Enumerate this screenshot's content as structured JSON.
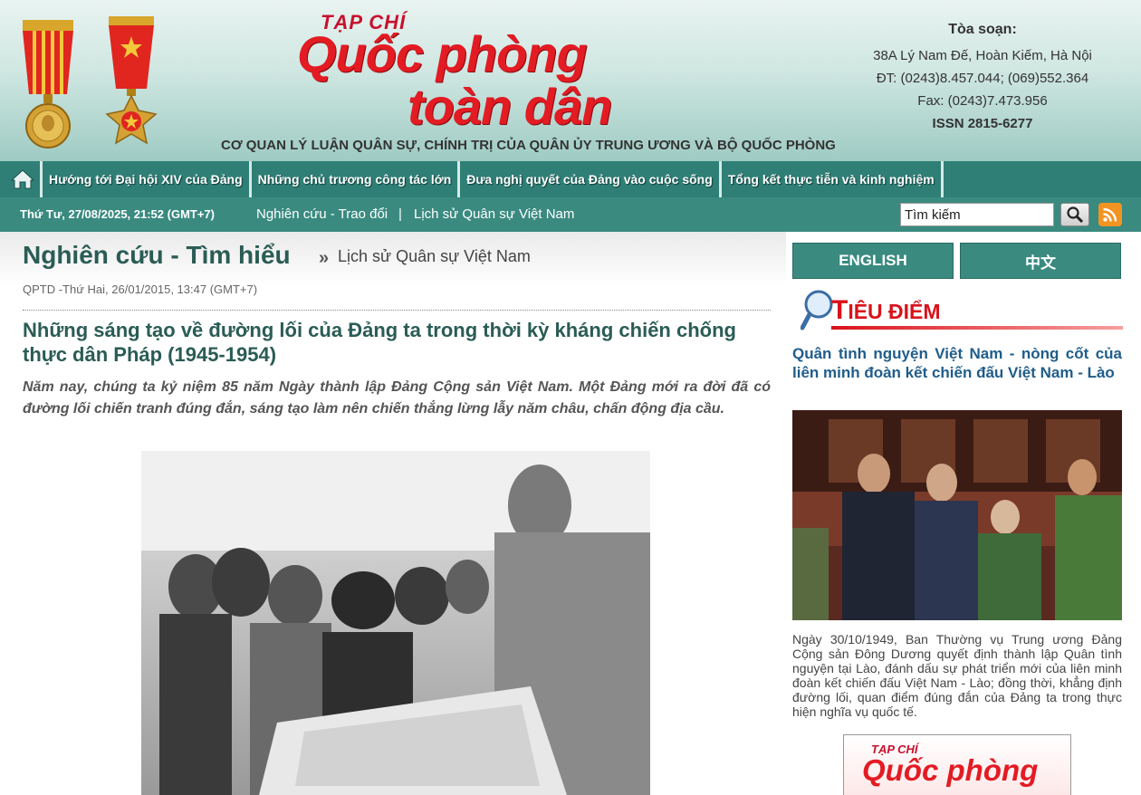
{
  "header": {
    "masthead_small": "TẠP CHÍ",
    "masthead_line1": "Quốc phòng",
    "masthead_line2": "toàn dân",
    "tagline": "CƠ QUAN LÝ LUẬN QUÂN SỰ, CHÍNH TRỊ CỦA QUÂN ỦY TRUNG ƯƠNG VÀ BỘ QUỐC PHÒNG",
    "contact": {
      "title": "Tòa soạn:",
      "address": "38A Lý Nam Đế, Hoàn Kiếm, Hà Nội",
      "phone": "ĐT: (0243)8.457.044; (069)552.364",
      "fax": "Fax: (0243)7.473.956",
      "issn": "ISSN 2815-6277"
    },
    "colors": {
      "brand_red": "#e31b23",
      "teal": "#2f7f76"
    }
  },
  "nav": {
    "home_icon": "home-icon",
    "items": [
      "Hướng tới Đại hội XIV của Đảng",
      "Những chủ trương công tác lớn",
      "Đưa nghị quyết của Đảng vào cuộc sống",
      "Tổng kết thực tiễn và kinh nghiệm"
    ]
  },
  "subbar": {
    "date": "Thứ Tư, 27/08/2025, 21:52 (GMT+7)",
    "crumb1": "Nghiên cứu - Trao đổi",
    "separator": "|",
    "crumb2": "Lịch sử Quân sự Việt Nam",
    "search_value": "Tìm kiếm",
    "search_icon": "magnifier-icon",
    "rss_icon": "rss-icon"
  },
  "main": {
    "section_title": "Nghiên cứu - Tìm hiểu",
    "section_arrow": "»",
    "section_sub": "Lịch sử Quân sự Việt Nam",
    "meta": "QPTD -Thứ Hai, 26/01/2015, 13:47 (GMT+7)",
    "article_title": "Những sáng tạo về đường lối của Đảng ta trong thời kỳ kháng chiến chống thực dân Pháp (1945-1954)",
    "article_sapo": "Năm nay, chúng ta kỷ niệm 85 năm Ngày thành lập Đảng Cộng sản Việt Nam. Một Đảng mới ra đời đã có đường lối chiến tranh đúng đắn, sáng tạo làm nên chiến thắng lừng lẫy năm châu, chấn động địa cầu."
  },
  "sidebar": {
    "lang_english": "ENGLISH",
    "lang_chinese": "中文",
    "focus_first": "T",
    "focus_rest": "IÊU ĐIỂM",
    "focus_title": "Quân tình nguyện Việt Nam - nòng cốt của liên minh đoàn kết chiến đấu Việt Nam - Lào",
    "focus_desc": "Ngày 30/10/1949, Ban Thường vụ Trung ương Đảng Cộng sản Đông Dương quyết định thành lập Quân tình nguyện tại Lào, đánh dấu sự phát triển mới của liên minh đoàn kết chiến đấu Việt Nam - Lào; đồng thời, khẳng định đường lối, quan điểm đúng đắn của Đảng ta trong thực hiện nghĩa vụ quốc tế.",
    "ad_small": "TẠP CHÍ",
    "ad_big": "Quốc phòng"
  }
}
